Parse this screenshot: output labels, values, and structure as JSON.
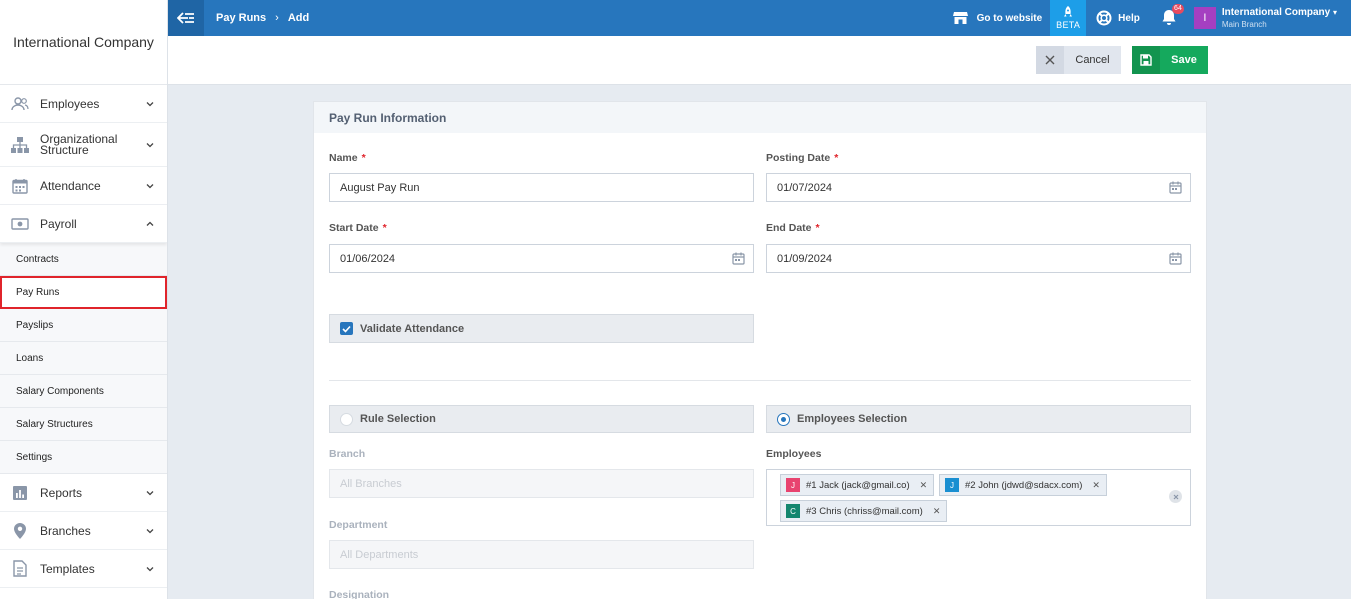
{
  "sidebar": {
    "brand": "International Company",
    "items": [
      {
        "label": "Employees",
        "icon": "users-icon"
      },
      {
        "label": "Organizational Structure",
        "icon": "org-chart-icon"
      },
      {
        "label": "Attendance",
        "icon": "calendar-icon"
      },
      {
        "label": "Payroll",
        "icon": "money-icon"
      }
    ],
    "payroll_sub": [
      {
        "label": "Contracts"
      },
      {
        "label": "Pay Runs"
      },
      {
        "label": "Payslips"
      },
      {
        "label": "Loans"
      },
      {
        "label": "Salary Components"
      },
      {
        "label": "Salary Structures"
      },
      {
        "label": "Settings"
      }
    ],
    "lower_items": [
      {
        "label": "Reports",
        "icon": "bar-chart-icon"
      },
      {
        "label": "Branches",
        "icon": "location-pin-icon"
      },
      {
        "label": "Templates",
        "icon": "document-icon"
      }
    ]
  },
  "topbar": {
    "breadcrumb": [
      "Pay Runs",
      "Add"
    ],
    "go_to_website": "Go to website",
    "beta": "BETA",
    "help": "Help",
    "notifications_count": "64",
    "account_initial": "I",
    "account_name": "International Company",
    "account_branch": "Main Branch"
  },
  "actions": {
    "cancel": "Cancel",
    "save": "Save"
  },
  "form": {
    "section_title": "Pay Run Information",
    "name_label": "Name",
    "name_value": "August Pay Run",
    "posting_date_label": "Posting Date",
    "posting_date_value": "01/07/2024",
    "start_date_label": "Start Date",
    "start_date_value": "01/06/2024",
    "end_date_label": "End Date",
    "end_date_value": "01/09/2024",
    "validate_attendance": "Validate Attendance",
    "rule_selection": "Rule Selection",
    "employees_selection": "Employees Selection",
    "branch_label": "Branch",
    "branch_placeholder": "All Branches",
    "department_label": "Department",
    "department_placeholder": "All Departments",
    "designation_label": "Designation",
    "employees_label": "Employees",
    "employees": [
      {
        "initial": "J",
        "label": "#1 Jack (jack@gmail.co)",
        "color": "#e8436f"
      },
      {
        "initial": "J",
        "label": "#2 John (jdwd@sdacx.com)",
        "color": "#1a8fd1"
      },
      {
        "initial": "C",
        "label": "#3 Chris (chriss@mail.com)",
        "color": "#13866e"
      }
    ]
  },
  "colors": {
    "topbar": "#2776bd",
    "save": "#15a95d",
    "active_outline": "#e0242b"
  }
}
